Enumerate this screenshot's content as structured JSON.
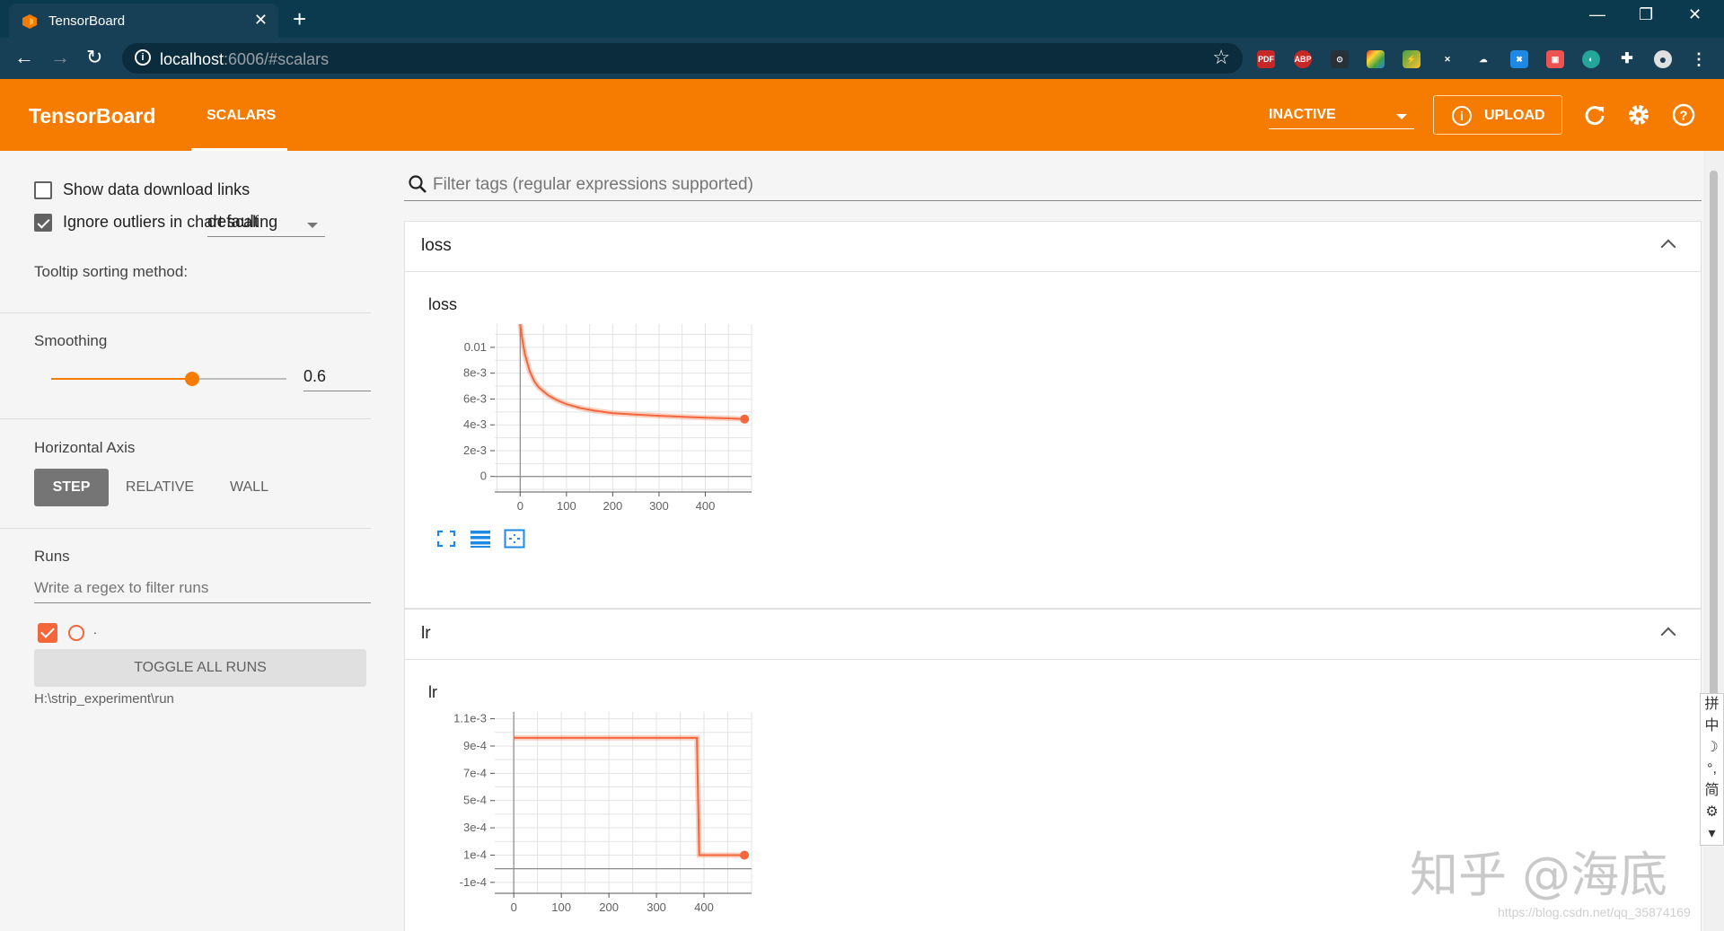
{
  "browser": {
    "tab_title": "TensorBoard",
    "url_host": "localhost",
    "url_path": ":6006/#scalars"
  },
  "header": {
    "title": "TensorBoard",
    "tab": "SCALARS",
    "run_state": "INACTIVE",
    "upload_label": "UPLOAD",
    "accent_color": "#f57c00"
  },
  "sidebar": {
    "show_download_label": "Show data download links",
    "show_download_checked": false,
    "ignore_outliers_label": "Ignore outliers in chart scaling",
    "ignore_outliers_checked": true,
    "tooltip_label": "Tooltip sorting method:",
    "tooltip_value": "default",
    "smoothing_label": "Smoothing",
    "smoothing_value": "0.6",
    "smoothing_fraction": 0.6,
    "axis_label": "Horizontal Axis",
    "axis_step": "STEP",
    "axis_relative": "RELATIVE",
    "axis_wall": "WALL",
    "runs_label": "Runs",
    "runs_filter_placeholder": "Write a regex to filter runs",
    "run_name": ".",
    "toggle_all": "TOGGLE ALL RUNS",
    "run_path": "H:\\strip_experiment\\run"
  },
  "main": {
    "filter_placeholder": "Filter tags (regular expressions supported)",
    "categories": [
      {
        "name": "loss",
        "card_title": "loss"
      },
      {
        "name": "lr",
        "card_title": "lr"
      }
    ]
  },
  "watermark": {
    "zhihu": "知乎 @海底",
    "url": "https://blog.csdn.net/qq_35874169"
  },
  "ime": [
    "拼",
    "中",
    "☽",
    "°,",
    "简",
    "⚙",
    "▾"
  ],
  "chart_data": [
    {
      "type": "line",
      "title": "loss",
      "color": "#f4673b",
      "x_ticks": [
        0,
        100,
        200,
        300,
        400
      ],
      "y_ticks": [
        0,
        0.002,
        0.004,
        0.006,
        0.008,
        0.01
      ],
      "y_tick_labels": [
        "0",
        "2e-3",
        "4e-3",
        "6e-3",
        "8e-3",
        "0.01"
      ],
      "xlim": [
        -55,
        500
      ],
      "ylim": [
        -0.0012,
        0.0118
      ],
      "series": [
        {
          "x": [
            0,
            5,
            10,
            20,
            30,
            40,
            60,
            80,
            100,
            130,
            160,
            200,
            250,
            300,
            350,
            400,
            450,
            485
          ],
          "y": [
            0.0118,
            0.0105,
            0.0095,
            0.0082,
            0.0074,
            0.0069,
            0.0063,
            0.0059,
            0.0056,
            0.0053,
            0.0051,
            0.0049,
            0.0048,
            0.0047,
            0.00462,
            0.00455,
            0.0045,
            0.00445
          ]
        }
      ]
    },
    {
      "type": "line",
      "title": "lr",
      "color": "#f4673b",
      "x_ticks": [
        0,
        100,
        200,
        300,
        400
      ],
      "y_ticks": [
        -0.0001,
        0.0001,
        0.0003,
        0.0005,
        0.0007,
        0.0009,
        0.0011
      ],
      "y_tick_labels": [
        "-1e-4",
        "1e-4",
        "3e-4",
        "5e-4",
        "7e-4",
        "9e-4",
        "1.1e-3"
      ],
      "xlim": [
        -40,
        500
      ],
      "ylim": [
        -0.00018,
        0.00115
      ],
      "series": [
        {
          "x": [
            0,
            385,
            390,
            485
          ],
          "y": [
            0.00096,
            0.00096,
            0.0001,
            0.0001
          ]
        }
      ]
    }
  ]
}
